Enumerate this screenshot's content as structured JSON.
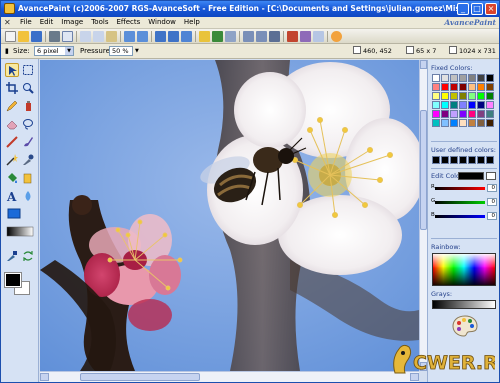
{
  "window": {
    "title": "AvancePaint (c)2006-2007 RGS-AvanceSoft - Free Edition - [C:\\Documents and Settings\\julian.gomez\\Mis documentos\\Mis imágen..."
  },
  "menu": {
    "items": [
      "File",
      "Edit",
      "Image",
      "Tools",
      "Effects",
      "Window",
      "Help"
    ],
    "brand": "AvancePaint"
  },
  "options": {
    "size_label": "Size:",
    "size_value": "6 pixel",
    "pressure_label": "Pressure:",
    "pressure_value": "50 %",
    "cursor_pos": "460, 452",
    "selection_size": "65 x 7",
    "image_size": "1024 x 731"
  },
  "colors_panel": {
    "fixed_label": "Fixed Colors:",
    "user_label": "User defined colors:",
    "edit_label": "Edit Color:",
    "slider_letters": [
      "R",
      "G",
      "B"
    ],
    "slider_values": [
      "0",
      "0",
      "0"
    ],
    "rainbow_label": "Rainbow:",
    "grays_label": "Grays:",
    "fixed_colors": [
      "#ffffff",
      "#e0e0e0",
      "#c0c0c0",
      "#a0a0a0",
      "#808080",
      "#404040",
      "#000000",
      "#ff8080",
      "#ff0000",
      "#c00000",
      "#800000",
      "#ffc080",
      "#ff8000",
      "#804000",
      "#ffff80",
      "#ffff00",
      "#c0c000",
      "#808000",
      "#80ff80",
      "#00ff00",
      "#008000",
      "#80ffff",
      "#00ffff",
      "#008080",
      "#8080ff",
      "#0000ff",
      "#000080",
      "#ff80ff",
      "#ff00ff",
      "#800080",
      "#c0a0ff",
      "#8000ff",
      "#ff0080",
      "#804080",
      "#408080",
      "#00c0c0",
      "#80c0ff",
      "#0080ff",
      "#ffe0c0",
      "#c08040",
      "#806040",
      "#402000"
    ],
    "user_colors": [
      "#000000",
      "#000000",
      "#000000",
      "#000000",
      "#000000",
      "#000000",
      "#000000"
    ]
  },
  "accent": {
    "titlebar": "#1656d6",
    "panel": "#d6e2f4",
    "sky": "#7ea6e3"
  },
  "watermark": "CWER.RU"
}
